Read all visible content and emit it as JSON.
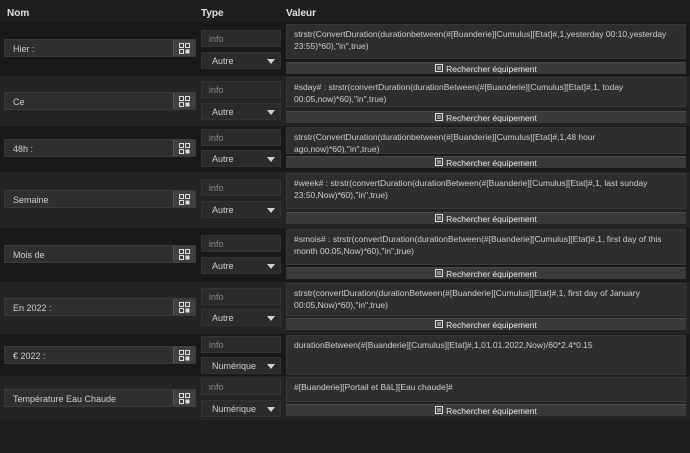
{
  "headers": {
    "name": "Nom",
    "type": "Type",
    "value": "Valeur"
  },
  "search_label": "Rechercher équipement",
  "rows": [
    {
      "name": "Hier :",
      "info": "info",
      "subtype": "Autre",
      "value": " strstr(ConvertDuration(durationbetween(#[Buanderie][Cumulus][Etat]#,1,yesterday 00:10,yesterday 23:55)*60),\"in\",true)"
    },
    {
      "name": "Ce",
      "info": "info",
      "subtype": "Autre",
      "value": "#sday# : strstr(convertDuration(durationBetween(#[Buanderie][Cumulus][Etat]#,1, today 00:05,now)*60),\"in\",true)"
    },
    {
      "name": "48h :",
      "info": "info",
      "subtype": "Autre",
      "value": "strstr(ConvertDuration(durationbetween(#[Buanderie][Cumulus][Etat]#,1,48 hour ago,now)*60),\"in\",true)"
    },
    {
      "name": "Semaine",
      "info": "info",
      "subtype": "Autre",
      "value": "#week# : strstr(convertDuration(durationBetween(#[Buanderie][Cumulus][Etat]#,1, last sunday 23:50,Now)*60),\"in\",true)"
    },
    {
      "name": "Mois de",
      "info": "info",
      "subtype": "Autre",
      "value": "#smois# : strstr(convertDuration(durationBetween(#[Buanderie][Cumulus][Etat]#,1, first day of this month 00:05,Now)*60),\"in\",true)"
    },
    {
      "name": "En 2022 :",
      "info": "info",
      "subtype": "Autre",
      "value": " strstr(convertDuration(durationBetween(#[Buanderie][Cumulus][Etat]#,1, first day of January 00:05,Now)*60),\"in\",true)"
    },
    {
      "name": "€  2022 :",
      "info": "info",
      "subtype": "Numérique",
      "value": "durationBetween(#[Buanderie][Cumulus][Etat]#,1,01.01.2022,Now)/60*2.4*0.15"
    },
    {
      "name": "Température Eau Chaude",
      "info": "info",
      "subtype": "Numérique",
      "value": "#[Buanderie][Portail et BàL][Eau chaude]#"
    }
  ]
}
